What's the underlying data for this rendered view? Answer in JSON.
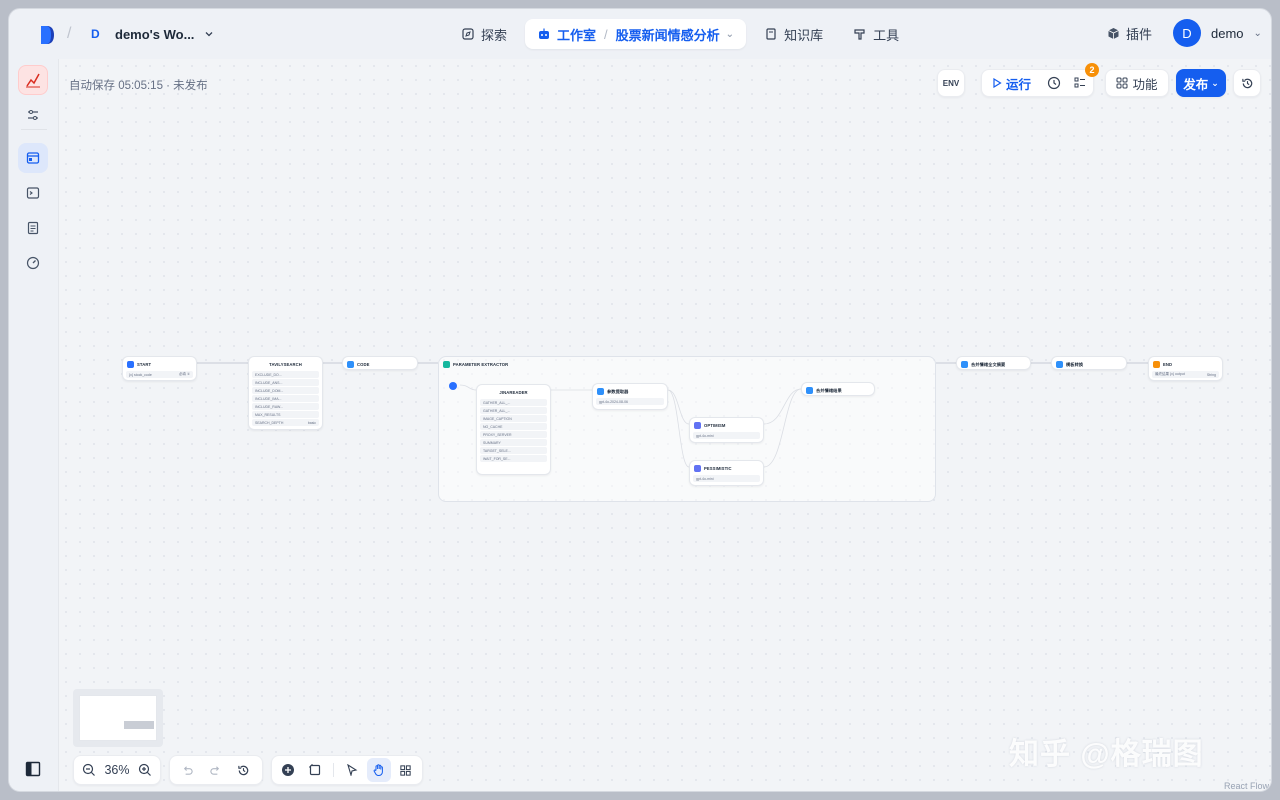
{
  "header": {
    "workspace_avatar": "D",
    "workspace_name": "demo's Wo...",
    "nav": {
      "explore": "探索",
      "studio": "工作室",
      "app_name": "股票新闻情感分析",
      "knowledge": "知识库",
      "tools": "工具"
    },
    "plugins": "插件",
    "user_avatar": "D",
    "user_name": "demo"
  },
  "canvas": {
    "autosave": "自动保存 05:05:15 · 未发布",
    "toolbar": {
      "env": "ENV",
      "run": "运行",
      "checklist_badge": "2",
      "features": "功能",
      "publish": "发布"
    },
    "zoom": "36%",
    "watermark": "知乎 @格瑞图",
    "attribution": "React Flow"
  },
  "nodes": {
    "start": {
      "title": "START",
      "row_label": "{x} stock_code",
      "row_value": "必填 ①"
    },
    "tavily": {
      "title": "TAVILYSEARCH",
      "rows": [
        "EXCLUDE_DO...",
        "INCLUDE_ANS...",
        "INCLUDE_DOM...",
        "INCLUDE_IMA...",
        "INCLUDE_RAW...",
        "MAX_RESULTS",
        "SEARCH_DEPTH"
      ],
      "last_value": "basic"
    },
    "code": {
      "title": "CODE"
    },
    "param": {
      "title": "PARAMETER EXTRACTOR"
    },
    "jina": {
      "title": "JINAREADER",
      "rows": [
        "GATHER_ALL_...",
        "GATHER_ALL_...",
        "IMAGE_CAPTION",
        "NO_CACHE",
        "PROXY_SERVER",
        "SUMMARY",
        "TARGET_SELE...",
        "WAIT_FOR_SE..."
      ]
    },
    "param_extract": {
      "title": "参数提取器",
      "model": "gpt-4o-2024-08-06"
    },
    "optimism": {
      "title": "OPTIMISM",
      "model": "gpt-4o-mini"
    },
    "pessimistic": {
      "title": "PESSIMISTIC",
      "model": "gpt-4o-mini"
    },
    "merge": {
      "title": "合并情绪结果"
    },
    "merge_all": {
      "title": "合并情绪全文摘要"
    },
    "template": {
      "title": "模板转换"
    },
    "end": {
      "title": "END",
      "row_label": "最终结果 {x} output",
      "row_value": "String"
    }
  },
  "colors": {
    "accent": "#155eef",
    "start_icon": "#2970ff",
    "tool_icon": "#2e90fa",
    "code_icon": "#2e90fa",
    "param_icon": "#15b79e",
    "llm_icon": "#6172f3",
    "end_icon": "#f79009"
  }
}
